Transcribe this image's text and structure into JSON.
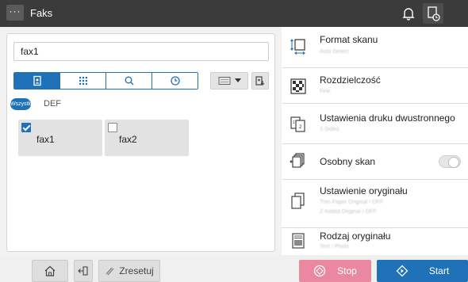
{
  "header": {
    "menu_label": "···",
    "title": "Faks"
  },
  "destination": {
    "value": "fax1"
  },
  "index": {
    "badge": "Wszystko",
    "label": "DEF"
  },
  "address_book": {
    "entries": [
      {
        "name": "fax1",
        "checked": true
      },
      {
        "name": "fax2",
        "checked": false
      }
    ]
  },
  "settings": [
    {
      "title": "Format skanu",
      "subtitle": "Auto Detect"
    },
    {
      "title": "Rozdzielczość",
      "subtitle": "Fine"
    },
    {
      "title": "Ustawienia druku dwustronnego",
      "subtitle": "1-Sided"
    },
    {
      "title": "Osobny skan",
      "toggle": "off"
    },
    {
      "title": "Ustawienie oryginału",
      "subtitle": "Thin Paper Original / OFF",
      "subtitle2": "Z-folded Original / OFF"
    },
    {
      "title": "Rodzaj oryginału",
      "subtitle": "Text / Photo"
    }
  ],
  "footer": {
    "reset_label": "Zresetuj",
    "stop_label": "Stop",
    "start_label": "Start"
  },
  "colors": {
    "accent": "#1f72b8",
    "stop": "#ea88a0",
    "header": "#3b3b3b"
  }
}
